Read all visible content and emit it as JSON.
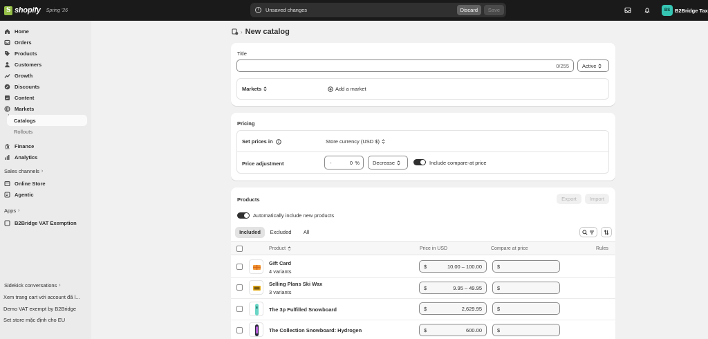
{
  "topbar": {
    "brand": "shopify",
    "version": "Spring '26",
    "unsaved_message": "Unsaved changes",
    "discard_label": "Discard",
    "save_label": "Save",
    "avatar_initials": "BS",
    "store_name": "B2Bridge Tax E"
  },
  "sidebar": {
    "items": [
      {
        "label": "Home",
        "icon": "home-icon"
      },
      {
        "label": "Orders",
        "icon": "orders-icon"
      },
      {
        "label": "Products",
        "icon": "tag-icon"
      },
      {
        "label": "Customers",
        "icon": "person-icon"
      },
      {
        "label": "Growth",
        "icon": "growth-icon"
      },
      {
        "label": "Discounts",
        "icon": "discount-icon"
      },
      {
        "label": "Content",
        "icon": "content-icon"
      },
      {
        "label": "Markets",
        "icon": "globe-icon"
      }
    ],
    "markets_sub": {
      "catalogs": "Catalogs",
      "rollouts": "Rollouts"
    },
    "items2": [
      {
        "label": "Finance",
        "icon": "finance-icon"
      },
      {
        "label": "Analytics",
        "icon": "analytics-icon"
      }
    ],
    "sales_channels_label": "Sales channels",
    "channels": [
      {
        "label": "Online Store",
        "icon": "store-icon"
      },
      {
        "label": "Agentic",
        "icon": "agentic-icon"
      }
    ],
    "apps_label": "Apps",
    "apps": [
      {
        "label": "B2Bridge VAT Exemption",
        "icon": "app-icon"
      }
    ],
    "sidekick_label": "Sidekick conversations",
    "conversations": [
      "Xem trang cart với account đã l...",
      "Demo VAT exempt by B2Bridge",
      "Set store mặc định cho EU"
    ]
  },
  "page": {
    "title": "New catalog"
  },
  "title_card": {
    "title_label": "Title",
    "title_value": "",
    "char_count": "0/255",
    "status_value": "Active",
    "markets_label": "Markets",
    "add_market_label": "Add a market"
  },
  "pricing_card": {
    "heading": "Pricing",
    "set_prices_label": "Set prices in",
    "currency_value": "Store currency (USD $)",
    "adjustment_label": "Price adjustment",
    "adjustment_prefix": "-",
    "adjustment_value": "0",
    "adjustment_unit": "%",
    "direction_value": "Decrease",
    "compare_label": "Include compare-at price"
  },
  "products_card": {
    "heading": "Products",
    "export_label": "Export",
    "import_label": "Import",
    "auto_include_label": "Automatically include new products",
    "tabs": [
      "Included",
      "Excluded",
      "All"
    ],
    "columns": {
      "product": "Product",
      "price": "Price in USD",
      "compare": "Compare at price",
      "rules": "Rules"
    },
    "currency_symbol": "$",
    "rows": [
      {
        "name": "Gift Card",
        "variants": "4 variants",
        "price": "10.00 – 100.00",
        "thumb": "gift-card-thumbnail"
      },
      {
        "name": "Selling Plans Ski Wax",
        "variants": "3 variants",
        "price": "9.95 – 49.95",
        "thumb": "ski-wax-thumbnail"
      },
      {
        "name": "The 3p Fulfilled Snowboard",
        "variants": "",
        "price": "2,629.95",
        "thumb": "snowboard-thumbnail"
      },
      {
        "name": "The Collection Snowboard: Hydrogen",
        "variants": "",
        "price": "600.00",
        "thumb": "snowboard-hydrogen-thumbnail"
      }
    ]
  },
  "colors": {
    "topbar_bg": "#1a1a1a",
    "sidebar_bg": "#ebebeb",
    "page_bg": "#f1f1f1",
    "avatar_bg": "#36c5b3",
    "logo_green": "#95bf47"
  }
}
